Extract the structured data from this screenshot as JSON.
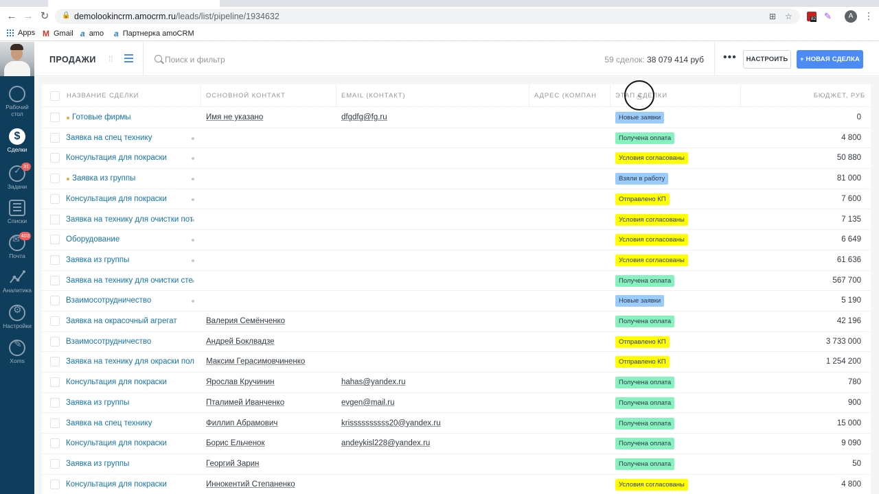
{
  "browser": {
    "url_host": "demolookincrm.amocrm.ru",
    "url_path": "/leads/list/pipeline/1934632",
    "profile_initial": "A",
    "extension_badge": "82"
  },
  "bookmarks": [
    {
      "label": "Apps",
      "icon": "apps-grid-icon"
    },
    {
      "label": "Gmail",
      "icon": "gmail-icon"
    },
    {
      "label": "amo",
      "icon": "amo-icon"
    },
    {
      "label": "Партнерка amoCRM",
      "icon": "amo-icon"
    }
  ],
  "sidebar": {
    "items": [
      {
        "label": "Рабочий стол",
        "icon": "dashboard-icon"
      },
      {
        "label": "Сделки",
        "icon": "deals-dollar-icon",
        "active": true
      },
      {
        "label": "Задачи",
        "icon": "tasks-check-icon",
        "badge": "31"
      },
      {
        "label": "Списки",
        "icon": "lists-icon"
      },
      {
        "label": "Почта",
        "icon": "mail-icon",
        "badge": "403"
      },
      {
        "label": "Аналитика",
        "icon": "analytics-icon"
      },
      {
        "label": "Настройки",
        "icon": "settings-icon"
      },
      {
        "label": "Xoms",
        "icon": "xoms-icon"
      }
    ]
  },
  "topbar": {
    "title": "ПРОДАЖИ",
    "search_placeholder": "Поиск и фильтр",
    "deals_count": "59 сделок:",
    "deals_sum": "38 079 414 руб",
    "more": "•••",
    "setup_button": "НАСТРОИТЬ",
    "new_deal_button": "+ НОВАЯ СДЕЛКА"
  },
  "table": {
    "columns": [
      "НАЗВАНИЕ СДЕЛКИ",
      "ОСНОВНОЙ КОНТАКТ",
      "EMAIL (КОНТАКТ)",
      "АДРЕС (КОМПАНИЯ)",
      "ЭТАП СДЕЛКИ",
      "БЮДЖЕТ, РУБ"
    ],
    "rows": [
      {
        "name": "Готовые фирмы",
        "contact": "Имя не указано",
        "email": "dfgdfg@fg.ru",
        "stage": "Новые заявки",
        "budget": "0",
        "lead_dot": true
      },
      {
        "name": "Заявка на спец технику",
        "contact": "",
        "email": "",
        "stage": "Получена оплата",
        "budget": "4 800"
      },
      {
        "name": "Консультация для покраски",
        "contact": "",
        "email": "",
        "stage": "Условия согласованы",
        "budget": "50 880"
      },
      {
        "name": "Заявка из группы",
        "contact": "",
        "email": "",
        "stage": "Взяли в работу",
        "budget": "81 000",
        "lead_dot": true
      },
      {
        "name": "Консультация для покраски",
        "contact": "",
        "email": "",
        "stage": "Отправлено КП",
        "budget": "7 600"
      },
      {
        "name": "Заявка на технику для очистки пот",
        "contact": "",
        "email": "",
        "stage": "Условия согласованы",
        "budget": "7 135"
      },
      {
        "name": "Оборудование",
        "contact": "",
        "email": "",
        "stage": "Условия согласованы",
        "budget": "6 649"
      },
      {
        "name": "Заявка из группы",
        "contact": "",
        "email": "",
        "stage": "Условия согласованы",
        "budget": "61 636"
      },
      {
        "name": "Заявка на технику для очистки сте",
        "contact": "",
        "email": "",
        "stage": "Получена оплата",
        "budget": "567 700"
      },
      {
        "name": "Взаимосотрудничество",
        "contact": "",
        "email": "",
        "stage": "Новые заявки",
        "budget": "5 190"
      },
      {
        "name": "Заявка на окрасочный агрегат",
        "contact": "Валерия Семёнченко",
        "email": "",
        "stage": "Получена оплата",
        "budget": "42 196"
      },
      {
        "name": "Взаимосотрудничество",
        "contact": "Андрей Боклвадзе",
        "email": "",
        "stage": "Отправлено КП",
        "budget": "3 733 000"
      },
      {
        "name": "Заявка на технику для окраски пол",
        "contact": "Максим Герасимовчиненко",
        "email": "",
        "stage": "Отправлено КП",
        "budget": "1 254 200"
      },
      {
        "name": "Консультация для покраски",
        "contact": "Ярослав Кручинин",
        "email": "hahas@yandex.ru",
        "stage": "Получена оплата",
        "budget": "780"
      },
      {
        "name": "Заявка из группы",
        "contact": "Пталимей Иванченко",
        "email": "evgen@mail.ru",
        "stage": "Получена оплата",
        "budget": "900"
      },
      {
        "name": "Заявка на спец технику",
        "contact": "Филлип Абрамович",
        "email": "krissssssssss20@yandex.ru",
        "stage": "Получена оплата",
        "budget": "15 000"
      },
      {
        "name": "Консультация для покраски",
        "contact": "Борис Ельченок",
        "email": "andeykisl228@yandex.ru",
        "stage": "Получена оплата",
        "budget": "9 090"
      },
      {
        "name": "Заявка из группы",
        "contact": "Георгий Зарин",
        "email": "",
        "stage": "Получена оплата",
        "budget": "50"
      },
      {
        "name": "Консультация для покраски",
        "contact": "Иннокентий Степаненко",
        "email": "",
        "stage": "Условия согласованы",
        "budget": "4 800"
      }
    ]
  },
  "stage_colors": {
    "Новые заявки": "#99ccfd",
    "Взяли в работу": "#99ccfd",
    "Получена оплата": "#87f2c0",
    "Условия согласованы": "#ffff00",
    "Отправлено КП": "#ffff00"
  },
  "colors": {
    "sidebar": "#0e3e5b",
    "accent": "#4c8bf5",
    "link": "#1375ab"
  }
}
